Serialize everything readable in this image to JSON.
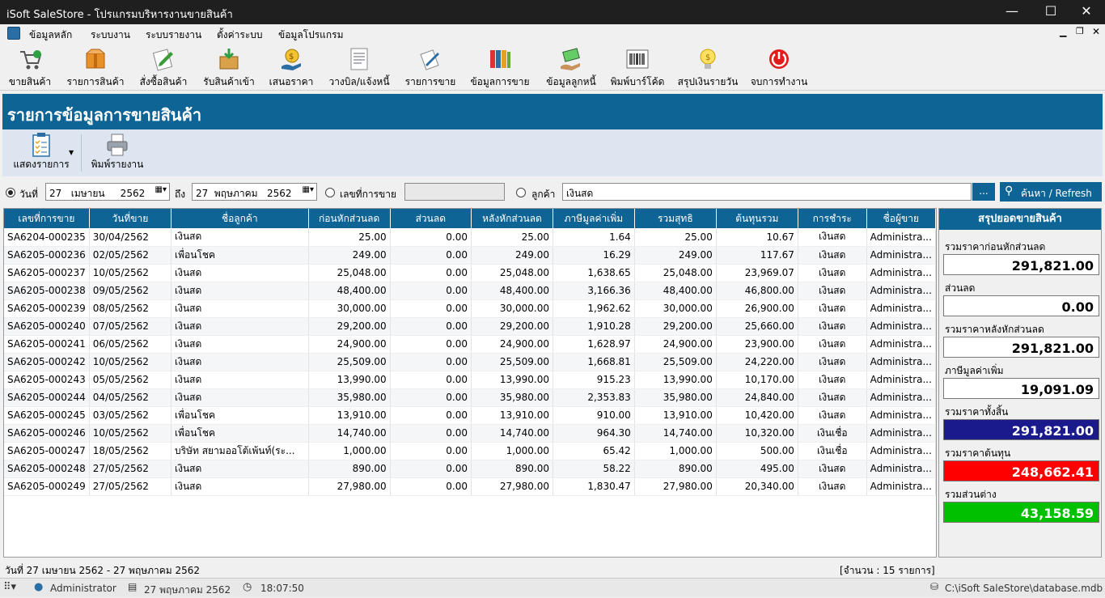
{
  "window": {
    "title": "iSoft SaleStore - โปรแกรมบริหารงานขายสินค้า",
    "minimize": "—",
    "maximize": "☐",
    "close": "✕"
  },
  "menu": [
    "ข้อมูลหลัก",
    "ระบบงาน",
    "ระบบรายงาน",
    "ตั้งค่าระบบ",
    "ข้อมูลโปรแกรม"
  ],
  "toolbar": [
    {
      "label": "ขายสินค้า",
      "icon": "cart-icon"
    },
    {
      "label": "รายการสินค้า",
      "icon": "box-icon"
    },
    {
      "label": "สั่งซื้อสินค้า",
      "icon": "order-pen-icon"
    },
    {
      "label": "รับสินค้าเข้า",
      "icon": "receive-box-icon"
    },
    {
      "label": "เสนอราคา",
      "icon": "quote-money-icon"
    },
    {
      "label": "วางบิล/แจ้งหนี้",
      "icon": "invoice-doc-icon"
    },
    {
      "label": "รายการขาย",
      "icon": "sales-list-icon"
    },
    {
      "label": "ข้อมูลการขาย",
      "icon": "binders-icon"
    },
    {
      "label": "ข้อมูลลูกหนี้",
      "icon": "debtor-money-icon"
    },
    {
      "label": "พิมพ์บาร์โค้ด",
      "icon": "barcode-icon"
    },
    {
      "label": "สรุปเงินรายวัน",
      "icon": "lightbulb-icon"
    },
    {
      "label": "จบการทำงาน",
      "icon": "power-icon"
    }
  ],
  "header": {
    "title": "รายการข้อมูลการขายสินค้า"
  },
  "actions": {
    "show_report": "แสดงรายการ",
    "print_report": "พิมพ์รายงาน"
  },
  "filters": {
    "date_label": "วันที่",
    "date_from": "27   เมษายน     2562",
    "to_label": "ถึง",
    "date_to": "27  พฤษภาคม   2562",
    "sale_no_label": "เลขที่การขาย",
    "sale_no_value": "",
    "customer_label": "ลูกค้า",
    "customer_value": "เงินสด",
    "browse": "...",
    "search_button": "ค้นหา / Refresh"
  },
  "table": {
    "columns": [
      "เลขที่การขาย",
      "วันที่ขาย",
      "ชื่อลูกค้า",
      "ก่อนหักส่วนลด",
      "ส่วนลด",
      "หลังหักส่วนลด",
      "ภาษีมูลค่าเพิ่ม",
      "รวมสุทธิ",
      "ต้นทุนรวม",
      "การชำระ",
      "ชื่อผู้ขาย"
    ],
    "rows": [
      [
        "SA6204-000235",
        "30/04/2562",
        "เงินสด",
        "25.00",
        "0.00",
        "25.00",
        "1.64",
        "25.00",
        "10.67",
        "เงินสด",
        "Administra..."
      ],
      [
        "SA6205-000236",
        "02/05/2562",
        "เพื่อนโชค",
        "249.00",
        "0.00",
        "249.00",
        "16.29",
        "249.00",
        "117.67",
        "เงินสด",
        "Administra..."
      ],
      [
        "SA6205-000237",
        "10/05/2562",
        "เงินสด",
        "25,048.00",
        "0.00",
        "25,048.00",
        "1,638.65",
        "25,048.00",
        "23,969.07",
        "เงินสด",
        "Administra..."
      ],
      [
        "SA6205-000238",
        "09/05/2562",
        "เงินสด",
        "48,400.00",
        "0.00",
        "48,400.00",
        "3,166.36",
        "48,400.00",
        "46,800.00",
        "เงินสด",
        "Administra..."
      ],
      [
        "SA6205-000239",
        "08/05/2562",
        "เงินสด",
        "30,000.00",
        "0.00",
        "30,000.00",
        "1,962.62",
        "30,000.00",
        "26,900.00",
        "เงินสด",
        "Administra..."
      ],
      [
        "SA6205-000240",
        "07/05/2562",
        "เงินสด",
        "29,200.00",
        "0.00",
        "29,200.00",
        "1,910.28",
        "29,200.00",
        "25,660.00",
        "เงินสด",
        "Administra..."
      ],
      [
        "SA6205-000241",
        "06/05/2562",
        "เงินสด",
        "24,900.00",
        "0.00",
        "24,900.00",
        "1,628.97",
        "24,900.00",
        "23,900.00",
        "เงินสด",
        "Administra..."
      ],
      [
        "SA6205-000242",
        "10/05/2562",
        "เงินสด",
        "25,509.00",
        "0.00",
        "25,509.00",
        "1,668.81",
        "25,509.00",
        "24,220.00",
        "เงินสด",
        "Administra..."
      ],
      [
        "SA6205-000243",
        "05/05/2562",
        "เงินสด",
        "13,990.00",
        "0.00",
        "13,990.00",
        "915.23",
        "13,990.00",
        "10,170.00",
        "เงินสด",
        "Administra..."
      ],
      [
        "SA6205-000244",
        "04/05/2562",
        "เงินสด",
        "35,980.00",
        "0.00",
        "35,980.00",
        "2,353.83",
        "35,980.00",
        "24,840.00",
        "เงินสด",
        "Administra..."
      ],
      [
        "SA6205-000245",
        "03/05/2562",
        "เพื่อนโชค",
        "13,910.00",
        "0.00",
        "13,910.00",
        "910.00",
        "13,910.00",
        "10,420.00",
        "เงินสด",
        "Administra..."
      ],
      [
        "SA6205-000246",
        "10/05/2562",
        "เพื่อนโชค",
        "14,740.00",
        "0.00",
        "14,740.00",
        "964.30",
        "14,740.00",
        "10,320.00",
        "เงินเชื่อ",
        "Administra..."
      ],
      [
        "SA6205-000247",
        "18/05/2562",
        "บริษัท สยามออโต้เพ้นท์(ระ...",
        "1,000.00",
        "0.00",
        "1,000.00",
        "65.42",
        "1,000.00",
        "500.00",
        "เงินเชื่อ",
        "Administra..."
      ],
      [
        "SA6205-000248",
        "27/05/2562",
        "เงินสด",
        "890.00",
        "0.00",
        "890.00",
        "58.22",
        "890.00",
        "495.00",
        "เงินสด",
        "Administra..."
      ],
      [
        "SA6205-000249",
        "27/05/2562",
        "เงินสด",
        "27,980.00",
        "0.00",
        "27,980.00",
        "1,830.47",
        "27,980.00",
        "20,340.00",
        "เงินสด",
        "Administra..."
      ]
    ]
  },
  "summary": {
    "title": "สรุปยอดขายสินค้า",
    "items": [
      {
        "label": "รวมราคาก่อนหักส่วนลด",
        "value": "291,821.00",
        "bg": "#ffffff",
        "fg": "#000000"
      },
      {
        "label": "ส่วนลด",
        "value": "0.00",
        "bg": "#ffffff",
        "fg": "#000000"
      },
      {
        "label": "รวมราคาหลังหักส่วนลด",
        "value": "291,821.00",
        "bg": "#ffffff",
        "fg": "#000000"
      },
      {
        "label": "ภาษีมูลค่าเพิ่ม",
        "value": "19,091.09",
        "bg": "#ffffff",
        "fg": "#000000"
      },
      {
        "label": "รวมราคาทั้งสิ้น",
        "value": "291,821.00",
        "bg": "#1a1a8c",
        "fg": "#ffffff"
      },
      {
        "label": "รวมราคาต้นทุน",
        "value": "248,662.41",
        "bg": "#ff0000",
        "fg": "#ffffff"
      },
      {
        "label": "รวมส่วนต่าง",
        "value": "43,158.59",
        "bg": "#00c000",
        "fg": "#ffffff"
      }
    ]
  },
  "footer": {
    "range": "วันที่ 27 เมษายน 2562  -  27 พฤษภาคม 2562",
    "count": "[จำนวน : 15 รายการ]"
  },
  "status": {
    "user": "Administrator",
    "date": "27 พฤษภาคม 2562",
    "time": "18:07:50",
    "db": "C:\\iSoft SaleStore\\database.mdb"
  }
}
